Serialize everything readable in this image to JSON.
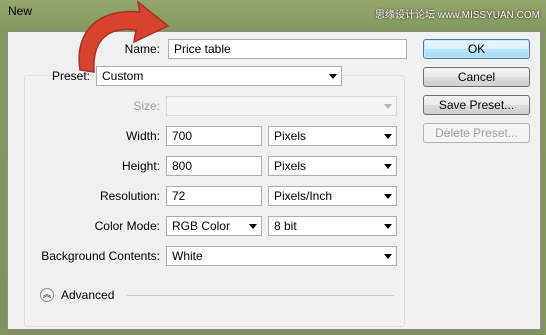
{
  "window": {
    "title": "New",
    "watermark": "思缘设计论坛 www.MISSYUAN.COM"
  },
  "form": {
    "name_label": "Name:",
    "name_value": "Price table",
    "preset_label": "Preset:",
    "preset_value": "Custom",
    "size_label": "Size:",
    "size_value": "",
    "width_label": "Width:",
    "width_value": "700",
    "width_unit": "Pixels",
    "height_label": "Height:",
    "height_value": "800",
    "height_unit": "Pixels",
    "resolution_label": "Resolution:",
    "resolution_value": "72",
    "resolution_unit": "Pixels/Inch",
    "color_mode_label": "Color Mode:",
    "color_mode_value": "RGB Color",
    "bit_depth_value": "8 bit",
    "bg_label": "Background Contents:",
    "bg_value": "White",
    "advanced_label": "Advanced"
  },
  "buttons": {
    "ok": "OK",
    "cancel": "Cancel",
    "save_preset": "Save Preset...",
    "delete_preset": "Delete Preset..."
  },
  "colors": {
    "annotation_arrow": "#d9442f",
    "default_button_border": "#3c7fb1"
  }
}
